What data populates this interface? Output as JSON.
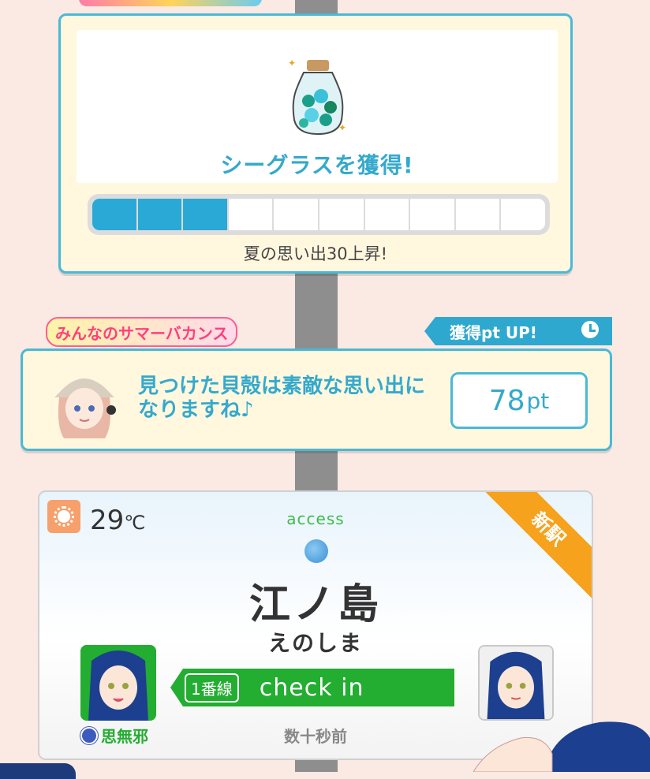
{
  "reward": {
    "title": "シーグラスを獲得!",
    "progress_filled": 3,
    "progress_total": 10,
    "caption": "夏の思い出30上昇!"
  },
  "event": {
    "logo_text": "みんなのサマーバカンス",
    "pt_up_label": "獲得pt UP!",
    "message": "見つけた貝殻は素敵な思い出になりますね♪",
    "points_value": "78",
    "points_unit": "pt"
  },
  "station": {
    "temperature": "29",
    "temperature_unit": "℃",
    "access_label": "access",
    "name": "江ノ島",
    "kana": "えのしま",
    "badge": "新駅",
    "line_label": "1番線",
    "checkin_label": "check in",
    "owner_name": "思無邪",
    "time_ago": "数十秒前"
  },
  "colors": {
    "accent_blue": "#35a9cc",
    "checkin_green": "#23ad31",
    "new_badge_orange": "#f6a21c"
  }
}
